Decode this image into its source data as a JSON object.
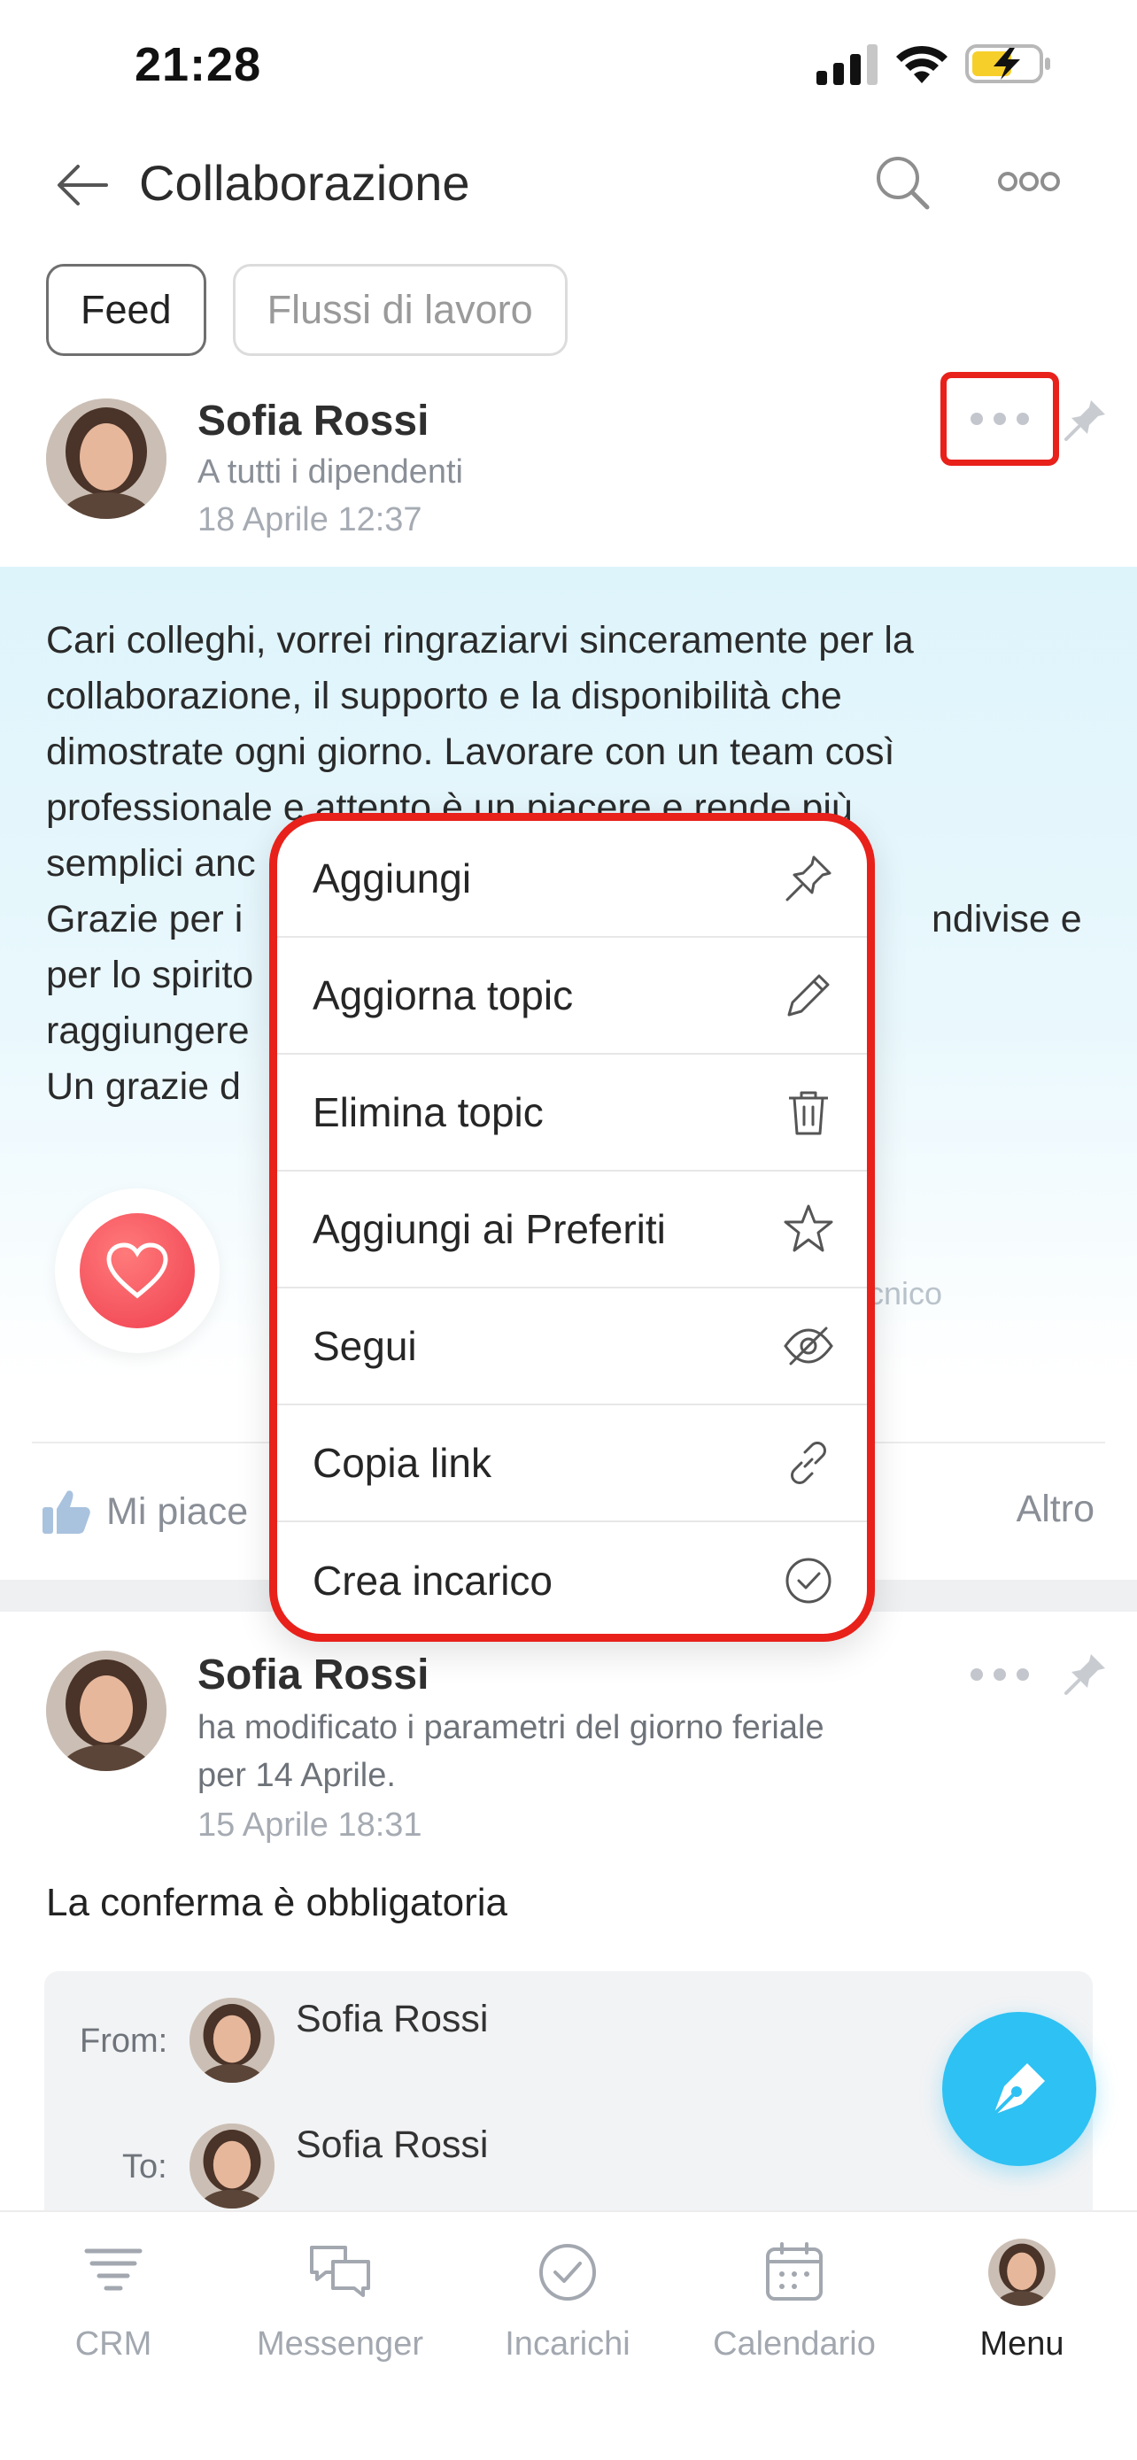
{
  "status_bar": {
    "time": "21:28"
  },
  "header": {
    "title": "Collaborazione"
  },
  "tabs": [
    {
      "label": "Feed",
      "active": true
    },
    {
      "label": "Flussi di lavoro",
      "active": false
    }
  ],
  "post1": {
    "author": "Sofia Rossi",
    "audience": "A tutti i dipendenti",
    "date": "18 Aprile 12:37",
    "text_lines": [
      "Cari colleghi, vorrei ringraziarvi sinceramente per la",
      "collaborazione, il supporto e la disponibilità che",
      "dimostrate ogni giorno. Lavorare con un team così",
      "professionale e attento è un piacere e rende più",
      "semplici anc",
      "Grazie per i",
      "per lo spirito",
      "raggiungere",
      "Un grazie d"
    ],
    "text_line_right_fragment": "ndivise e",
    "faded_caption": "ecnico",
    "like_label": "Mi piace",
    "more_label": "Altro"
  },
  "menu": {
    "items": [
      {
        "label": "Aggiungi",
        "icon": "pin-icon"
      },
      {
        "label": "Aggiorna topic",
        "icon": "pencil-icon"
      },
      {
        "label": "Elimina topic",
        "icon": "trash-icon"
      },
      {
        "label": "Aggiungi ai Preferiti",
        "icon": "star-icon"
      },
      {
        "label": "Segui",
        "icon": "eye-off-icon"
      },
      {
        "label": "Copia link",
        "icon": "link-icon"
      },
      {
        "label": "Crea incarico",
        "icon": "check-circle-icon"
      }
    ]
  },
  "post2": {
    "author": "Sofia Rossi",
    "action_line1": "ha modificato i parametri del giorno feriale",
    "action_line2": "per 14 Aprile.",
    "date": "15 Aprile 18:31",
    "body": "La conferma è obbligatoria",
    "from_label": "From:",
    "from_name": "Sofia Rossi",
    "to_label": "To:",
    "to_name": "Sofia Rossi"
  },
  "tabbar": {
    "items": [
      {
        "label": "CRM",
        "icon": "crm-icon"
      },
      {
        "label": "Messenger",
        "icon": "chat-icon"
      },
      {
        "label": "Incarichi",
        "icon": "check-circle-icon"
      },
      {
        "label": "Calendario",
        "icon": "calendar-icon"
      },
      {
        "label": "Menu",
        "icon": "avatar",
        "active": true
      }
    ]
  },
  "colors": {
    "accent_red": "#e8211b",
    "fab_blue": "#2ec1f3",
    "heart_red": "#ef4050"
  }
}
